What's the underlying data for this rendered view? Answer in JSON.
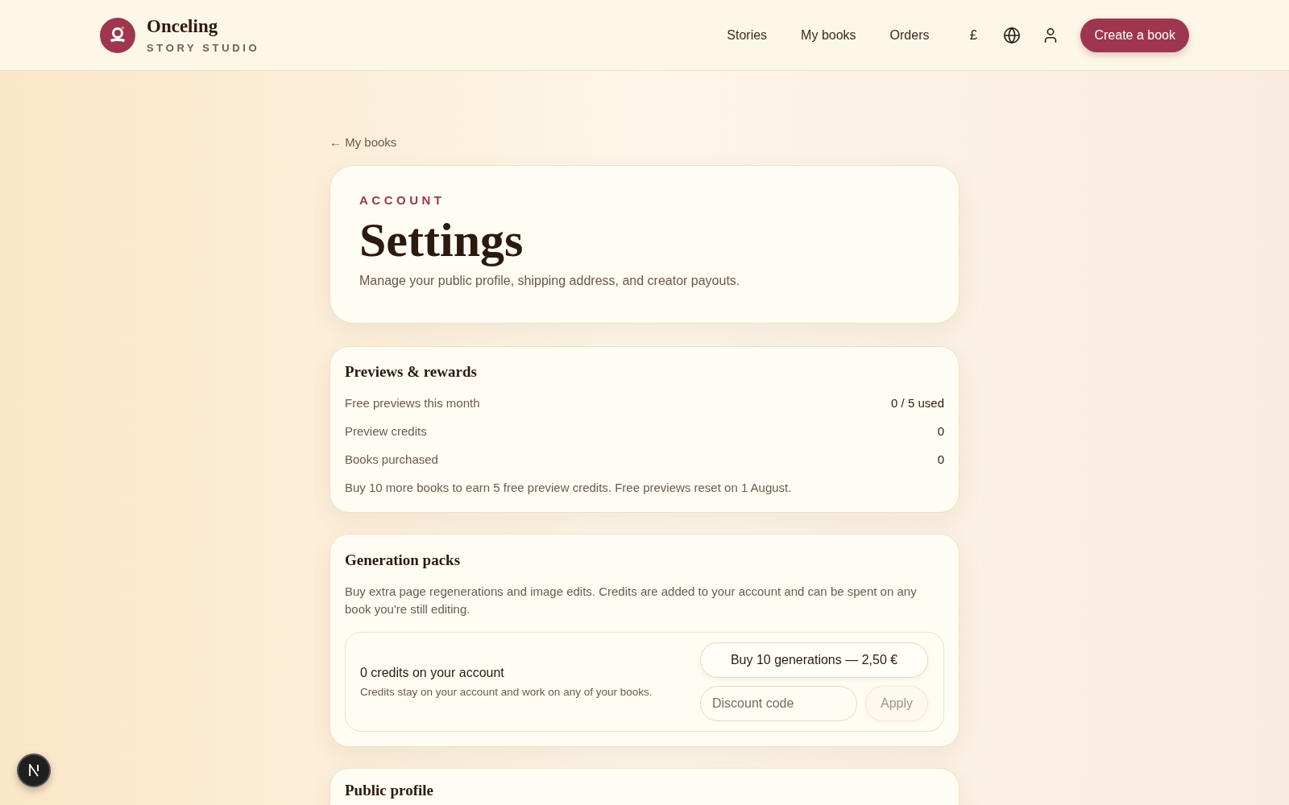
{
  "header": {
    "brand": {
      "name": "Onceling",
      "tagline": "STORY STUDIO"
    },
    "nav": [
      {
        "label": "Stories"
      },
      {
        "label": "My books"
      },
      {
        "label": "Orders"
      }
    ],
    "currency": "£",
    "cta": "Create a book"
  },
  "back_link": "← My books",
  "intro": {
    "eyebrow": "ACCOUNT",
    "title": "Settings",
    "description": "Manage your public profile, shipping address, and creator payouts."
  },
  "sections": [
    {
      "kind": "stats",
      "title": "Previews & rewards",
      "rows": [
        {
          "label": "Free previews this month",
          "value": "0 / 5 used"
        },
        {
          "label": "Preview credits",
          "value": "0"
        },
        {
          "label": "Books purchased",
          "value": "0"
        }
      ],
      "note": "Buy 10 more books to earn 5 free preview credits. Free previews reset on 1 August."
    },
    {
      "kind": "packs",
      "title": "Generation packs",
      "description": "Buy extra page regenerations and image edits. Credits are added to your account and can be spent on any book you're still editing.",
      "balance": {
        "title": "0 credits on your account",
        "note": "Credits stay on your account and work on any of your books."
      },
      "buy_button": "Buy 10 generations — 2,50 €",
      "discount": {
        "placeholder": "Discount code"
      },
      "apply_button": {
        "label": "Apply",
        "disabled": true
      }
    },
    {
      "kind": "heading",
      "title": "Public profile"
    }
  ]
}
